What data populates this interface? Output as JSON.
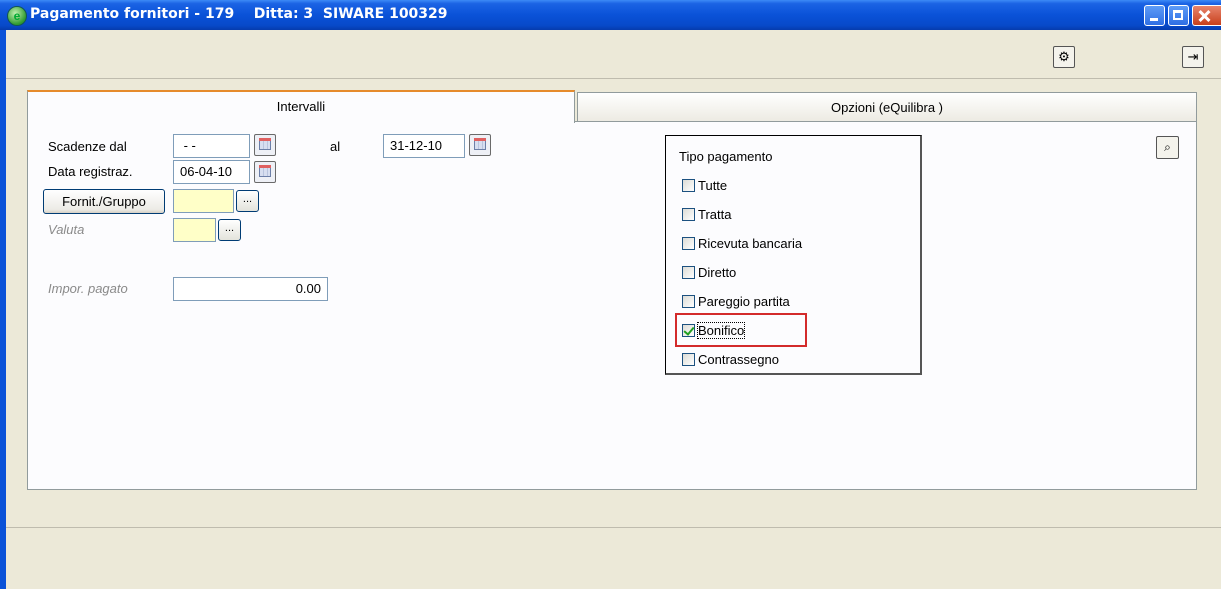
{
  "window": {
    "title": "Pagamento fornitori - 179    Ditta: 3  SIWARE 100329",
    "icons": [
      "app-icon",
      "minimize-icon",
      "maximize-icon",
      "close-icon"
    ]
  },
  "toolbar": {
    "icons": [
      "settings-icon",
      "exit-door-icon"
    ]
  },
  "tabs": [
    {
      "label": "Intervalli",
      "active": true
    },
    {
      "label": "Opzioni (eQuilibra )",
      "active": false
    }
  ],
  "form": {
    "scadenze_dal_label": "Scadenze dal",
    "scadenze_dal_value": " - -",
    "al_label": "al",
    "al_value": "31-12-10",
    "data_registraz_label": "Data registraz.",
    "data_registraz_value": "06-04-10",
    "fornit_gruppo_button": "Fornit./Gruppo",
    "fornit_gruppo_value": "",
    "valuta_label": "Valuta",
    "valuta_value": "",
    "impor_pagato_label": "Impor. pagato",
    "impor_pagato_value": "0.00",
    "lookup_button": "..."
  },
  "tipo_pagamento": {
    "title": "Tipo pagamento",
    "options": [
      {
        "label": "Tutte",
        "checked": false
      },
      {
        "label": "Tratta",
        "checked": false
      },
      {
        "label": "Ricevuta bancaria",
        "checked": false
      },
      {
        "label": "Diretto",
        "checked": false
      },
      {
        "label": "Pareggio partita",
        "checked": false
      },
      {
        "label": "Bonifico",
        "checked": true
      },
      {
        "label": "Contrassegno",
        "checked": false
      }
    ]
  },
  "colors": {
    "titlebar": "#0a52d8",
    "active_tab_accent": "#e68b2c",
    "highlight_box": "#d32b2b",
    "yellow_field": "#ffffc8",
    "checkmark": "#21a121"
  }
}
